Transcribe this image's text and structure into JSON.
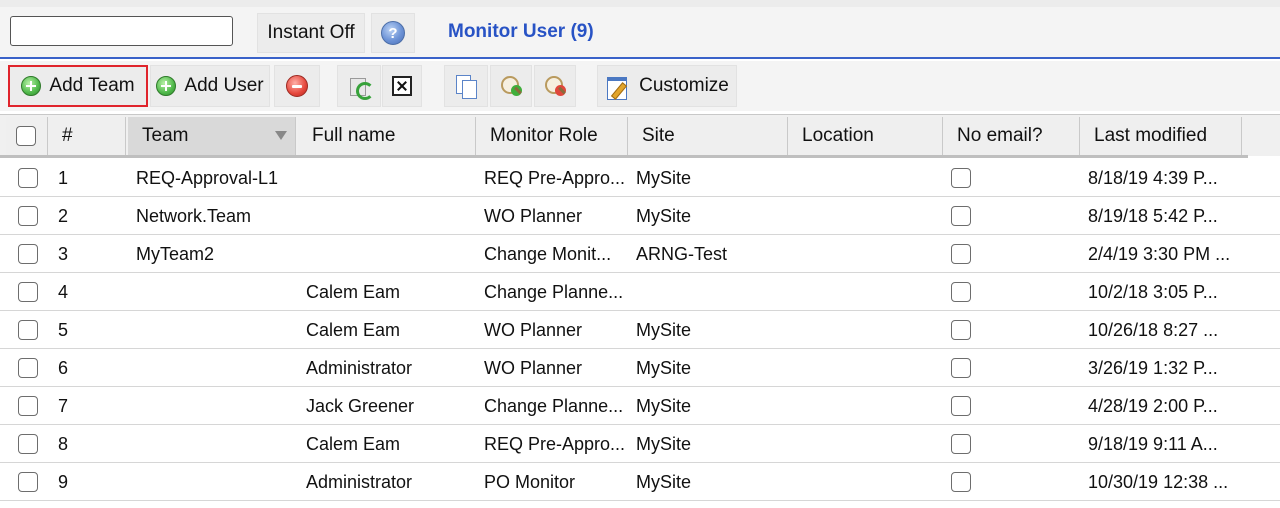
{
  "search": {
    "value": "",
    "placeholder": ""
  },
  "header": {
    "instant_label": "Instant Off",
    "help_icon": "help-icon",
    "title": "Monitor User (9)",
    "title_color": "#2853c5"
  },
  "toolbar": {
    "add_team_label": "Add Team",
    "add_user_label": "Add User",
    "customize_label": "Customize",
    "highlight_color": "#e0242c"
  },
  "table": {
    "columns": [
      "#",
      "Team",
      "Full name",
      "Monitor Role",
      "Site",
      "Location",
      "No email?",
      "Last modified"
    ],
    "sorted_column": "Team",
    "rows": [
      {
        "num": "1",
        "team": "REQ-Approval-L1",
        "full_name": "",
        "role": "REQ Pre-Appro...",
        "site": "MySite",
        "location": "",
        "modified": "8/18/19 4:39 P..."
      },
      {
        "num": "2",
        "team": "Network.Team",
        "full_name": "",
        "role": "WO Planner",
        "site": "MySite",
        "location": "",
        "modified": "8/19/18 5:42 P..."
      },
      {
        "num": "3",
        "team": "MyTeam2",
        "full_name": "",
        "role": "Change Monit...",
        "site": "ARNG-Test",
        "location": "",
        "modified": "2/4/19 3:30 PM ..."
      },
      {
        "num": "4",
        "team": "",
        "full_name": "Calem Eam",
        "role": "Change Planne...",
        "site": "",
        "location": "",
        "modified": "10/2/18 3:05 P..."
      },
      {
        "num": "5",
        "team": "",
        "full_name": "Calem Eam",
        "role": "WO Planner",
        "site": "MySite",
        "location": "",
        "modified": "10/26/18 8:27 ..."
      },
      {
        "num": "6",
        "team": "",
        "full_name": "Administrator",
        "role": "WO Planner",
        "site": "MySite",
        "location": "",
        "modified": "3/26/19 1:32 P..."
      },
      {
        "num": "7",
        "team": "",
        "full_name": "Jack Greener",
        "role": "Change Planne...",
        "site": "MySite",
        "location": "",
        "modified": "4/28/19 2:00 P..."
      },
      {
        "num": "8",
        "team": "",
        "full_name": "Calem Eam",
        "role": "REQ Pre-Appro...",
        "site": "MySite",
        "location": "",
        "modified": "9/18/19 9:11 A..."
      },
      {
        "num": "9",
        "team": "",
        "full_name": "Administrator",
        "role": "PO Monitor",
        "site": "MySite",
        "location": "",
        "modified": "10/30/19 12:38 ..."
      }
    ]
  }
}
